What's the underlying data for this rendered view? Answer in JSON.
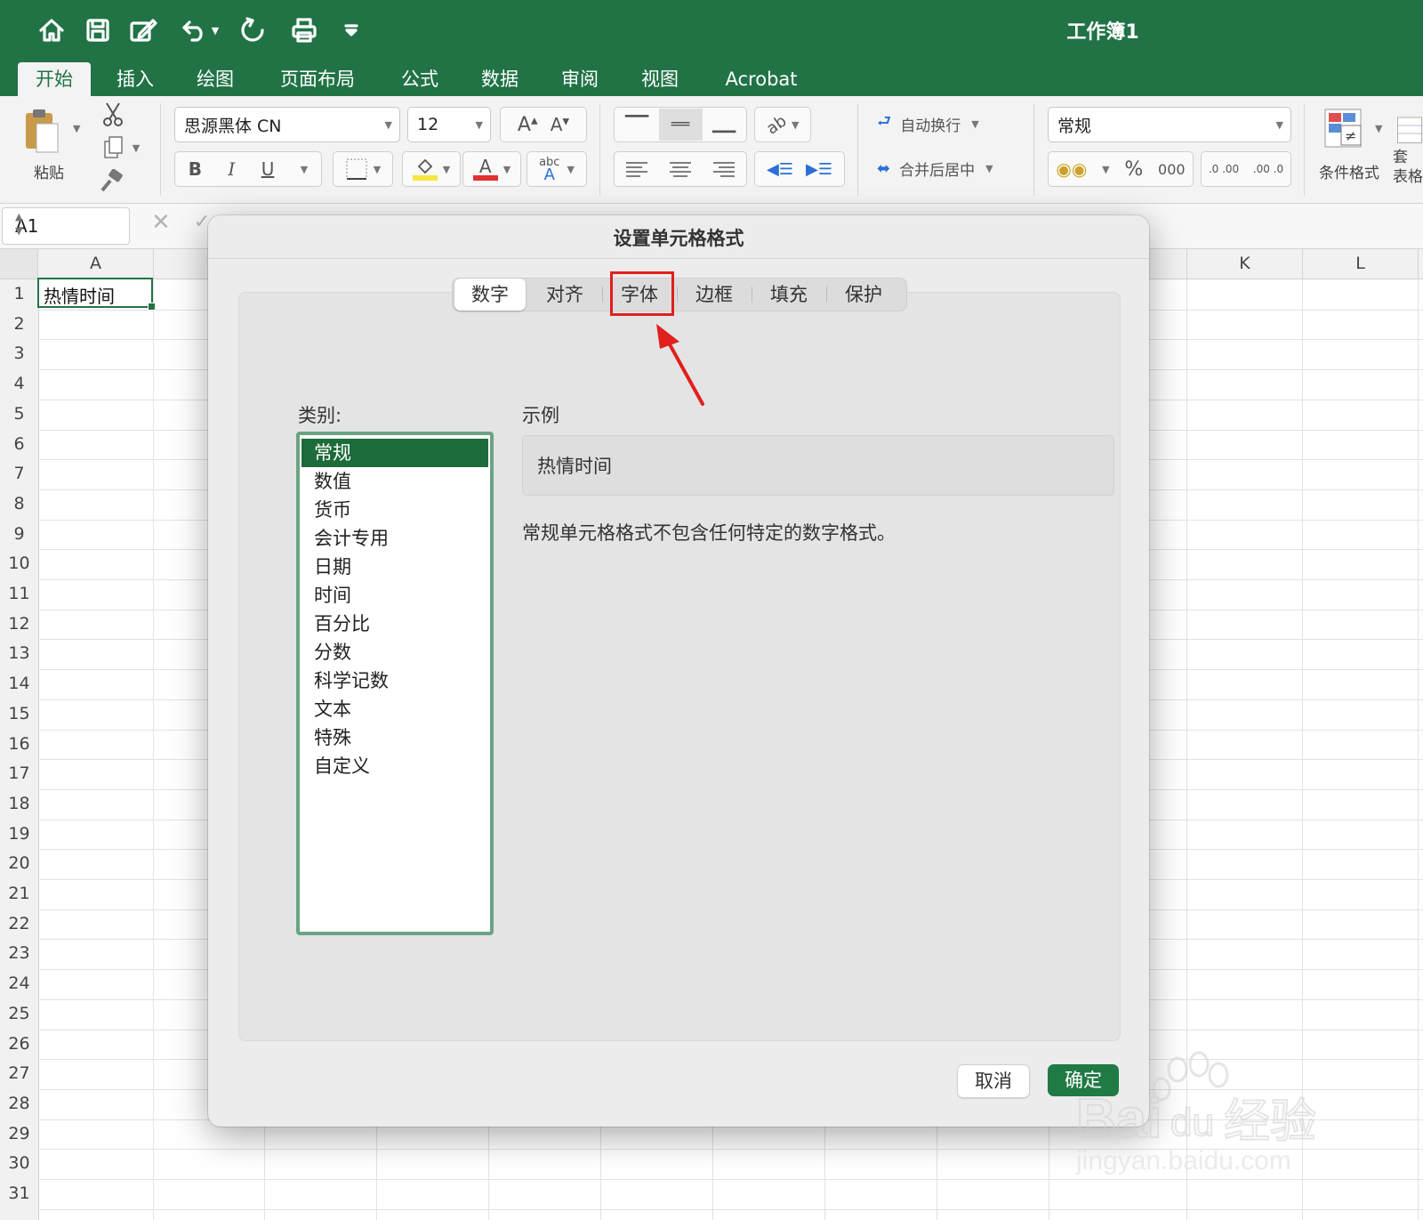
{
  "title_bar": {
    "workbook_title": "工作簿1",
    "quick_access": [
      "home-icon",
      "save-icon",
      "edit-icon",
      "undo-icon",
      "redo-icon",
      "print-icon",
      "customize-icon"
    ]
  },
  "ribbon_tabs": [
    "开始",
    "插入",
    "绘图",
    "页面布局",
    "公式",
    "数据",
    "审阅",
    "视图",
    "Acrobat"
  ],
  "active_tab": "开始",
  "ribbon": {
    "paste_label": "粘贴",
    "font_name": "思源黑体 CN",
    "font_size": "12",
    "wrap_text": "自动换行",
    "merge_center": "合并后居中",
    "number_format": "常规",
    "percent": "%",
    "thousands": "000",
    "increase_decimal": ".0 .00",
    "decrease_decimal": ".00 .0",
    "conditional_format": "条件格式",
    "table_format_partial": "套 表格",
    "bold": "B",
    "italic": "I",
    "underline": "U",
    "abc": "abc",
    "font_color_letter": "A"
  },
  "formula_bar": {
    "name_box": "A1"
  },
  "sheet": {
    "columns": [
      "A",
      "K",
      "L"
    ],
    "rows": [
      "1",
      "2",
      "3",
      "4",
      "5",
      "6",
      "7",
      "8",
      "9",
      "10",
      "11",
      "12",
      "13",
      "14",
      "15",
      "16",
      "17",
      "18",
      "19",
      "20",
      "21",
      "22",
      "23",
      "24",
      "25",
      "26",
      "27",
      "28",
      "29",
      "30",
      "31"
    ],
    "cell_a1": "热情时间"
  },
  "dialog": {
    "title": "设置单元格格式",
    "tabs": [
      "数字",
      "对齐",
      "字体",
      "边框",
      "填充",
      "保护"
    ],
    "active_tab": "数字",
    "highlighted_tab": "字体",
    "category_label": "类别:",
    "categories": [
      "常规",
      "数值",
      "货币",
      "会计专用",
      "日期",
      "时间",
      "百分比",
      "分数",
      "科学记数",
      "文本",
      "特殊",
      "自定义"
    ],
    "selected_category": "常规",
    "sample_label": "示例",
    "sample_value": "热情时间",
    "description": "常规单元格格式不包含任何特定的数字格式。",
    "cancel_label": "取消",
    "ok_label": "确定"
  },
  "watermark": {
    "text": "Bai经验",
    "url": "jingyan.baidu.com"
  },
  "colors": {
    "excel_green": "#217346",
    "ok_button": "#1f7a43",
    "highlight_red": "#e0201d"
  }
}
